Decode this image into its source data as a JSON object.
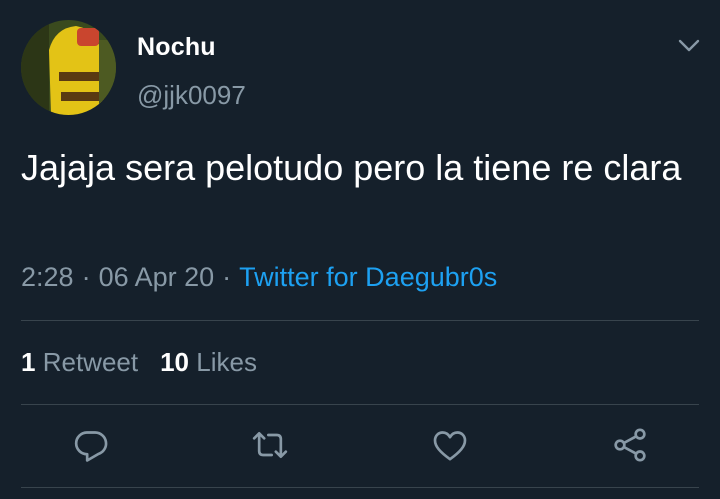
{
  "user": {
    "display_name": "Nochu",
    "handle": "@jjk0097"
  },
  "tweet": {
    "text": "Jajaja sera pelotudo pero la tiene re clara",
    "time": "2:28",
    "separator": "·",
    "date": "06 Apr 20",
    "source": "Twitter for Daegubr0s"
  },
  "stats": {
    "retweets_count": "1",
    "retweets_label": "Retweet",
    "likes_count": "10",
    "likes_label": "Likes"
  },
  "actions": [
    "reply-icon",
    "retweet-icon",
    "like-icon",
    "share-icon"
  ],
  "colors": {
    "background": "#15202b",
    "primary_text": "#ffffff",
    "secondary_text": "#8899a6",
    "link": "#1da1f2",
    "divider": "#38444d"
  }
}
